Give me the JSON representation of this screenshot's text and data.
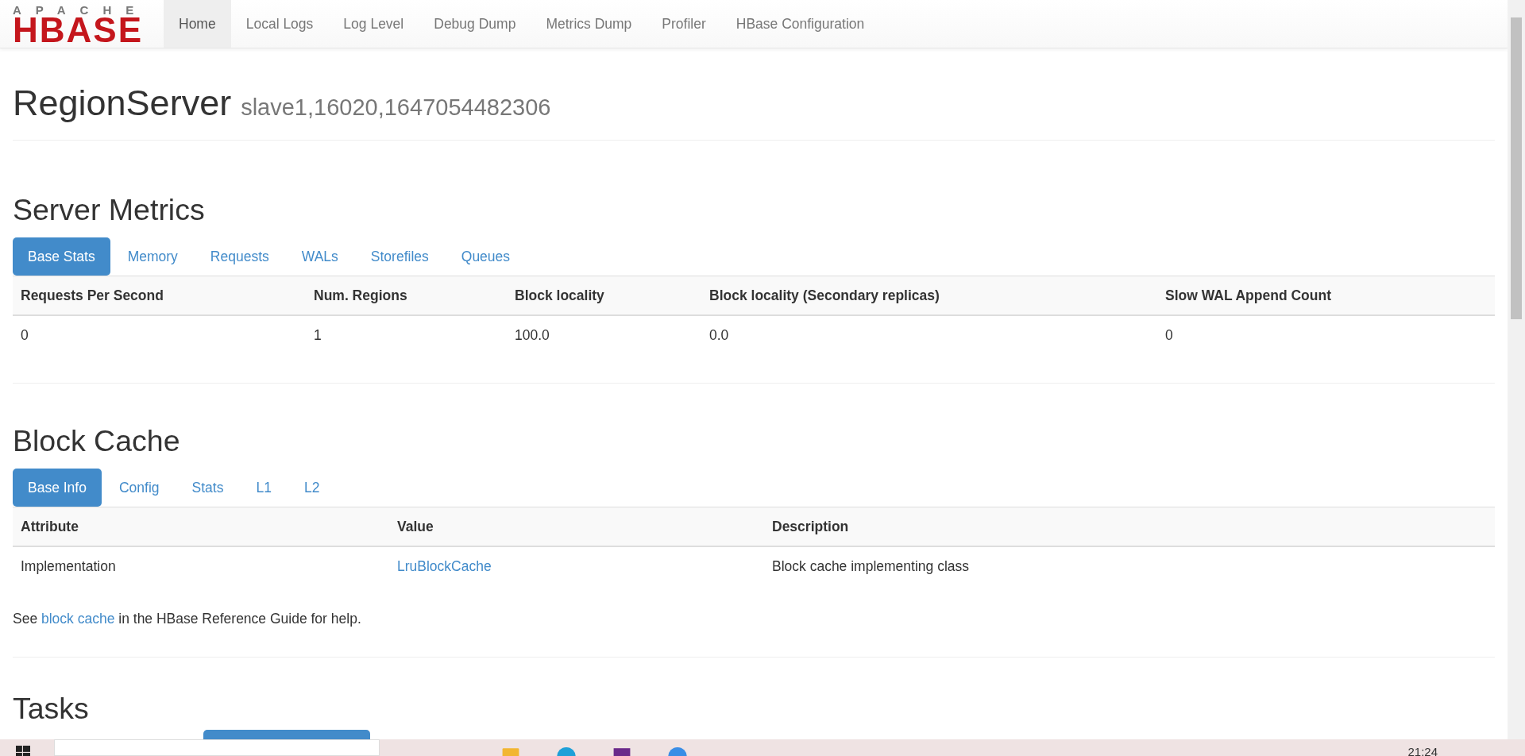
{
  "navbar": {
    "logo": {
      "top": "APACHE",
      "main": "HBASE"
    },
    "items": [
      {
        "label": "Home",
        "selected": true
      },
      {
        "label": "Local Logs",
        "selected": false
      },
      {
        "label": "Log Level",
        "selected": false
      },
      {
        "label": "Debug Dump",
        "selected": false
      },
      {
        "label": "Metrics Dump",
        "selected": false
      },
      {
        "label": "Profiler",
        "selected": false
      },
      {
        "label": "HBase Configuration",
        "selected": false
      }
    ]
  },
  "header": {
    "title": "RegionServer",
    "subtitle": "slave1,16020,1647054482306"
  },
  "sections": [
    {
      "title": "Server Metrics",
      "tabs": [
        {
          "label": "Base Stats",
          "selected": true
        },
        {
          "label": "Memory",
          "selected": false
        },
        {
          "label": "Requests",
          "selected": false
        },
        {
          "label": "WALs",
          "selected": false
        },
        {
          "label": "Storefiles",
          "selected": false
        },
        {
          "label": "Queues",
          "selected": false
        }
      ],
      "table": {
        "columns": [
          "Requests Per Second",
          "Num. Regions",
          "Block locality",
          "Block locality (Secondary replicas)",
          "Slow WAL Append Count"
        ],
        "rows": [
          [
            {
              "text": "0",
              "kind": "text"
            },
            {
              "text": "1",
              "kind": "text"
            },
            {
              "text": "100.0",
              "kind": "text"
            },
            {
              "text": "0.0",
              "kind": "text"
            },
            {
              "text": "0",
              "kind": "text"
            }
          ]
        ]
      }
    },
    {
      "title": "Block Cache",
      "tabs": [
        {
          "label": "Base Info",
          "selected": true
        },
        {
          "label": "Config",
          "selected": false
        },
        {
          "label": "Stats",
          "selected": false
        },
        {
          "label": "L1",
          "selected": false
        },
        {
          "label": "L2",
          "selected": false
        }
      ],
      "table": {
        "columns": [
          "Attribute",
          "Value",
          "Description"
        ],
        "rows": [
          [
            {
              "text": "Implementation",
              "kind": "text"
            },
            {
              "text": "LruBlockCache",
              "kind": "link"
            },
            {
              "text": "Block cache implementing class",
              "kind": "text"
            }
          ]
        ]
      },
      "note": {
        "before": "See",
        "link": "block cache",
        "after": "in the HBase Reference Guide for help."
      }
    },
    {
      "title": "Tasks"
    }
  ],
  "taskbar": {
    "time": "21:24"
  }
}
